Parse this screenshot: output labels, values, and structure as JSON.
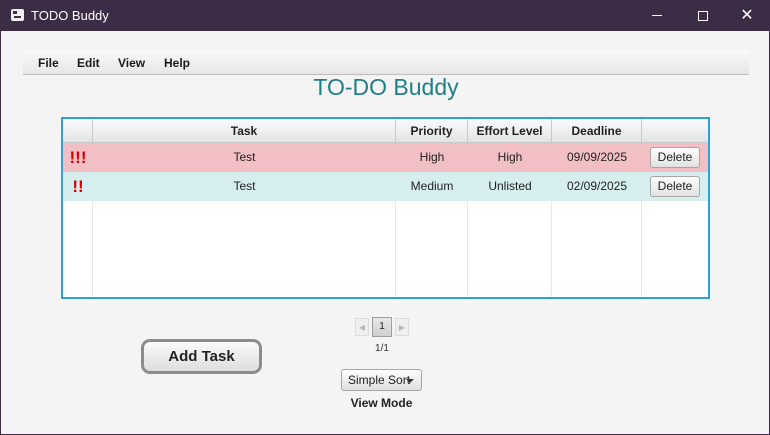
{
  "window": {
    "title": "TODO Buddy",
    "close_glyph": "✕"
  },
  "menu": {
    "items": [
      "File",
      "Edit",
      "View",
      "Help"
    ]
  },
  "app_title": "TO-DO Buddy",
  "table": {
    "columns": [
      "",
      "Task",
      "Priority",
      "Effort Level",
      "Deadline",
      ""
    ],
    "rows": [
      {
        "flag": "!!!",
        "task": "Test",
        "priority": "High",
        "effort": "High",
        "deadline": "09/09/2025",
        "action": "Delete"
      },
      {
        "flag": "!!",
        "task": "Test",
        "priority": "Medium",
        "effort": "Unlisted",
        "deadline": "02/09/2025",
        "action": "Delete"
      }
    ],
    "colors": {
      "high_row": "#f2c0c4",
      "medium_row": "#d6eeee",
      "flag": "#d40000",
      "border": "#2aa2e0"
    }
  },
  "pagination": {
    "current_page": "1",
    "count_text": "1/1",
    "prev_glyph": "◀",
    "next_glyph": "▶"
  },
  "add_task_label": "Add Task",
  "sort": {
    "selected": "Simple Sort",
    "label": "View Mode"
  },
  "colors": {
    "titlebar": "#3d2c45",
    "accent": "#1f7f86"
  }
}
